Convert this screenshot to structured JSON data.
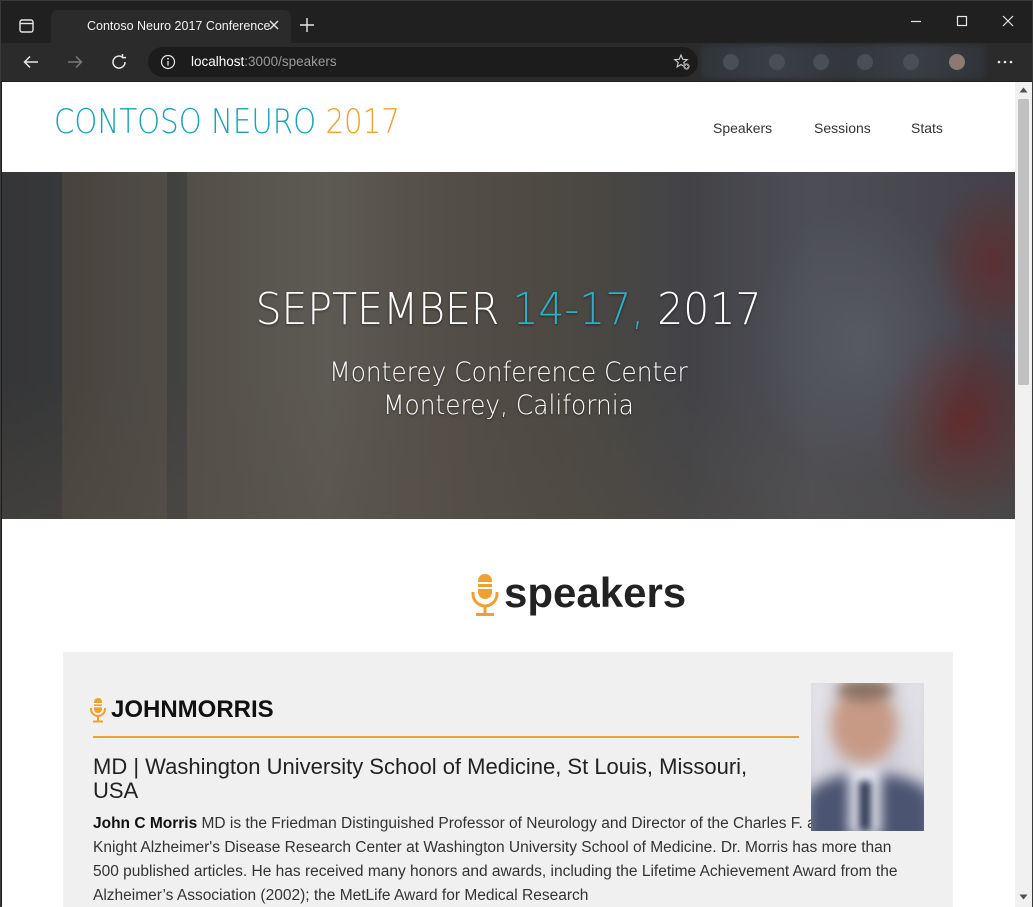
{
  "browser": {
    "tab_title": "Contoso Neuro 2017 Conference",
    "url_host": "localhost",
    "url_rest": ":3000/speakers"
  },
  "site": {
    "logo_brand": "CONTOSO NEURO ",
    "logo_year": "2017",
    "nav": [
      "Speakers",
      "Sessions",
      "Stats"
    ],
    "colors": {
      "teal": "#1aa3b5",
      "orange": "#f0a030"
    }
  },
  "hero": {
    "date_prefix": "SEPTEMBER ",
    "date_accent": "14-17,",
    "date_suffix": " 2017",
    "venue_line1": "Monterey Conference Center",
    "venue_line2": "Monterey, California"
  },
  "speakers_section": {
    "heading": "speakers",
    "icon": "microphone-icon"
  },
  "speaker": {
    "name": "JOHNMORRIS",
    "affiliation": "MD | Washington University School of Medicine, St Louis, Missouri, USA",
    "bio_name": "John C Morris",
    "bio_text": " MD is the Friedman Distinguished Professor of Neurology and Director of the Charles F. and Joanne Knight Alzheimer's Disease Research Center at Washington University School of Medicine. Dr. Morris has more than 500 published articles. He has received many honors and awards, including the Lifetime Achievement Award from the Alzheimer’s Association (2002); the MetLife Award for Medical Research"
  }
}
